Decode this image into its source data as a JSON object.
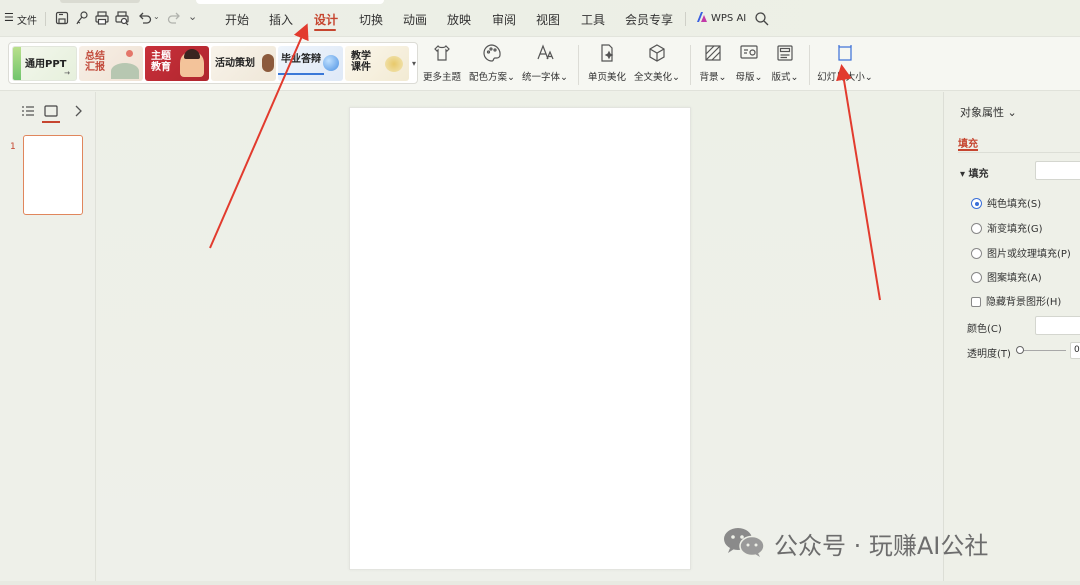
{
  "menubar": {
    "file_label": "文件",
    "icons": [
      "menu-icon",
      "save-icon",
      "share-icon",
      "print-icon",
      "print-preview-icon",
      "undo-icon",
      "redo-icon",
      "more-icon"
    ],
    "tabs": [
      {
        "label": "开始",
        "active": false
      },
      {
        "label": "插入",
        "active": false
      },
      {
        "label": "设计",
        "active": true
      },
      {
        "label": "切换",
        "active": false
      },
      {
        "label": "动画",
        "active": false
      },
      {
        "label": "放映",
        "active": false
      },
      {
        "label": "审阅",
        "active": false
      },
      {
        "label": "视图",
        "active": false
      },
      {
        "label": "工具",
        "active": false
      },
      {
        "label": "会员专享",
        "active": false
      }
    ],
    "wps_ai_label": "WPS AI",
    "accent_color": "#c6452f"
  },
  "ribbon": {
    "themes": [
      {
        "label": "通用PPT"
      },
      {
        "label": "总结\n汇报"
      },
      {
        "label": "主题\n教育"
      },
      {
        "label": "活动策划"
      },
      {
        "label": "毕业答辩"
      },
      {
        "label": "教学\n课件"
      }
    ],
    "buttons": {
      "more_themes": "更多主题",
      "color_scheme": "配色方案",
      "unify_font": "统一字体",
      "single_page_beautify": "单页美化",
      "full_text_beautify": "全文美化",
      "background": "背景",
      "master": "母版",
      "layout": "版式",
      "slide_size": "幻灯片大小"
    }
  },
  "left_pane": {
    "slide_number": "1"
  },
  "right_panel": {
    "title": "对象属性",
    "subtab": "填充",
    "fill_section": "填充",
    "options": [
      {
        "label": "纯色填充(S)",
        "checked": true
      },
      {
        "label": "渐变填充(G)",
        "checked": false
      },
      {
        "label": "图片或纹理填充(P)",
        "checked": false
      },
      {
        "label": "图案填充(A)",
        "checked": false
      }
    ],
    "hide_bg_label": "隐藏背景图形(H)",
    "color_label": "颜色(C)",
    "transparency_label": "透明度(T)",
    "transparency_value": "0"
  },
  "watermark": {
    "text": "公众号 · 玩赚AI公社"
  }
}
